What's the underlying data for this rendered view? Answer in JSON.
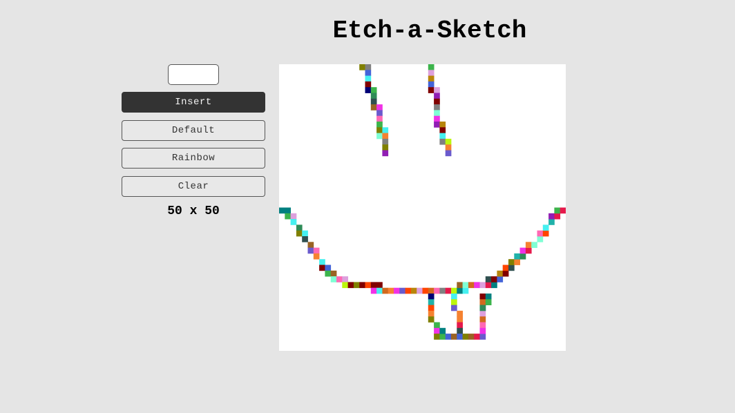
{
  "app": {
    "title": "Etch-a-Sketch"
  },
  "controls": {
    "size_input_value": "",
    "buttons": [
      {
        "label": "Insert",
        "active": true
      },
      {
        "label": "Default",
        "active": false
      },
      {
        "label": "Rainbow",
        "active": false
      },
      {
        "label": "Clear",
        "active": false
      }
    ],
    "size_label": "50 x 50"
  },
  "grid": {
    "rows": 50,
    "cols": 50,
    "background": "#ffffff",
    "painted_cells": [
      [
        0,
        14
      ],
      [
        0,
        15
      ],
      [
        1,
        15
      ],
      [
        2,
        15
      ],
      [
        3,
        15
      ],
      [
        4,
        15
      ],
      [
        4,
        16
      ],
      [
        5,
        16
      ],
      [
        6,
        16
      ],
      [
        7,
        16
      ],
      [
        7,
        17
      ],
      [
        8,
        17
      ],
      [
        9,
        17
      ],
      [
        10,
        17
      ],
      [
        11,
        17
      ],
      [
        11,
        18
      ],
      [
        12,
        17
      ],
      [
        12,
        18
      ],
      [
        13,
        18
      ],
      [
        14,
        18
      ],
      [
        15,
        18
      ],
      [
        0,
        26
      ],
      [
        1,
        26
      ],
      [
        2,
        26
      ],
      [
        3,
        26
      ],
      [
        4,
        26
      ],
      [
        4,
        27
      ],
      [
        5,
        27
      ],
      [
        6,
        27
      ],
      [
        7,
        27
      ],
      [
        8,
        27
      ],
      [
        9,
        27
      ],
      [
        10,
        27
      ],
      [
        10,
        28
      ],
      [
        11,
        28
      ],
      [
        12,
        28
      ],
      [
        13,
        28
      ],
      [
        13,
        29
      ],
      [
        14,
        29
      ],
      [
        15,
        29
      ],
      [
        25,
        0
      ],
      [
        25,
        1
      ],
      [
        26,
        1
      ],
      [
        26,
        2
      ],
      [
        27,
        2
      ],
      [
        28,
        3
      ],
      [
        29,
        3
      ],
      [
        29,
        4
      ],
      [
        30,
        4
      ],
      [
        31,
        5
      ],
      [
        32,
        5
      ],
      [
        32,
        6
      ],
      [
        33,
        6
      ],
      [
        34,
        7
      ],
      [
        35,
        7
      ],
      [
        35,
        8
      ],
      [
        36,
        8
      ],
      [
        36,
        9
      ],
      [
        37,
        9
      ],
      [
        37,
        10
      ],
      [
        37,
        11
      ],
      [
        38,
        11
      ],
      [
        38,
        12
      ],
      [
        38,
        13
      ],
      [
        38,
        14
      ],
      [
        38,
        15
      ],
      [
        38,
        16
      ],
      [
        38,
        17
      ],
      [
        39,
        16
      ],
      [
        39,
        17
      ],
      [
        39,
        18
      ],
      [
        39,
        19
      ],
      [
        39,
        20
      ],
      [
        39,
        21
      ],
      [
        39,
        22
      ],
      [
        39,
        23
      ],
      [
        39,
        24
      ],
      [
        39,
        25
      ],
      [
        39,
        26
      ],
      [
        39,
        27
      ],
      [
        39,
        28
      ],
      [
        39,
        29
      ],
      [
        39,
        30
      ],
      [
        39,
        31
      ],
      [
        39,
        32
      ],
      [
        38,
        31
      ],
      [
        38,
        32
      ],
      [
        38,
        33
      ],
      [
        38,
        34
      ],
      [
        38,
        35
      ],
      [
        38,
        36
      ],
      [
        38,
        37
      ],
      [
        37,
        36
      ],
      [
        37,
        37
      ],
      [
        37,
        38
      ],
      [
        36,
        38
      ],
      [
        36,
        39
      ],
      [
        35,
        39
      ],
      [
        35,
        40
      ],
      [
        34,
        40
      ],
      [
        34,
        41
      ],
      [
        33,
        41
      ],
      [
        33,
        42
      ],
      [
        32,
        42
      ],
      [
        32,
        43
      ],
      [
        31,
        43
      ],
      [
        31,
        44
      ],
      [
        30,
        45
      ],
      [
        29,
        45
      ],
      [
        29,
        46
      ],
      [
        28,
        46
      ],
      [
        27,
        47
      ],
      [
        26,
        47
      ],
      [
        26,
        48
      ],
      [
        25,
        48
      ],
      [
        25,
        49
      ],
      [
        40,
        26
      ],
      [
        41,
        26
      ],
      [
        42,
        26
      ],
      [
        43,
        26
      ],
      [
        44,
        26
      ],
      [
        45,
        27
      ],
      [
        46,
        27
      ],
      [
        47,
        27
      ],
      [
        47,
        28
      ],
      [
        46,
        28
      ],
      [
        40,
        30
      ],
      [
        41,
        30
      ],
      [
        42,
        30
      ],
      [
        43,
        31
      ],
      [
        44,
        31
      ],
      [
        45,
        31
      ],
      [
        46,
        31
      ],
      [
        47,
        29
      ],
      [
        47,
        30
      ],
      [
        47,
        31
      ],
      [
        47,
        32
      ],
      [
        47,
        33
      ],
      [
        47,
        34
      ],
      [
        47,
        35
      ],
      [
        40,
        35
      ],
      [
        41,
        35
      ],
      [
        42,
        35
      ],
      [
        43,
        35
      ],
      [
        44,
        35
      ],
      [
        45,
        35
      ],
      [
        46,
        35
      ],
      [
        40,
        36
      ],
      [
        41,
        36
      ],
      [
        42,
        35
      ]
    ]
  }
}
